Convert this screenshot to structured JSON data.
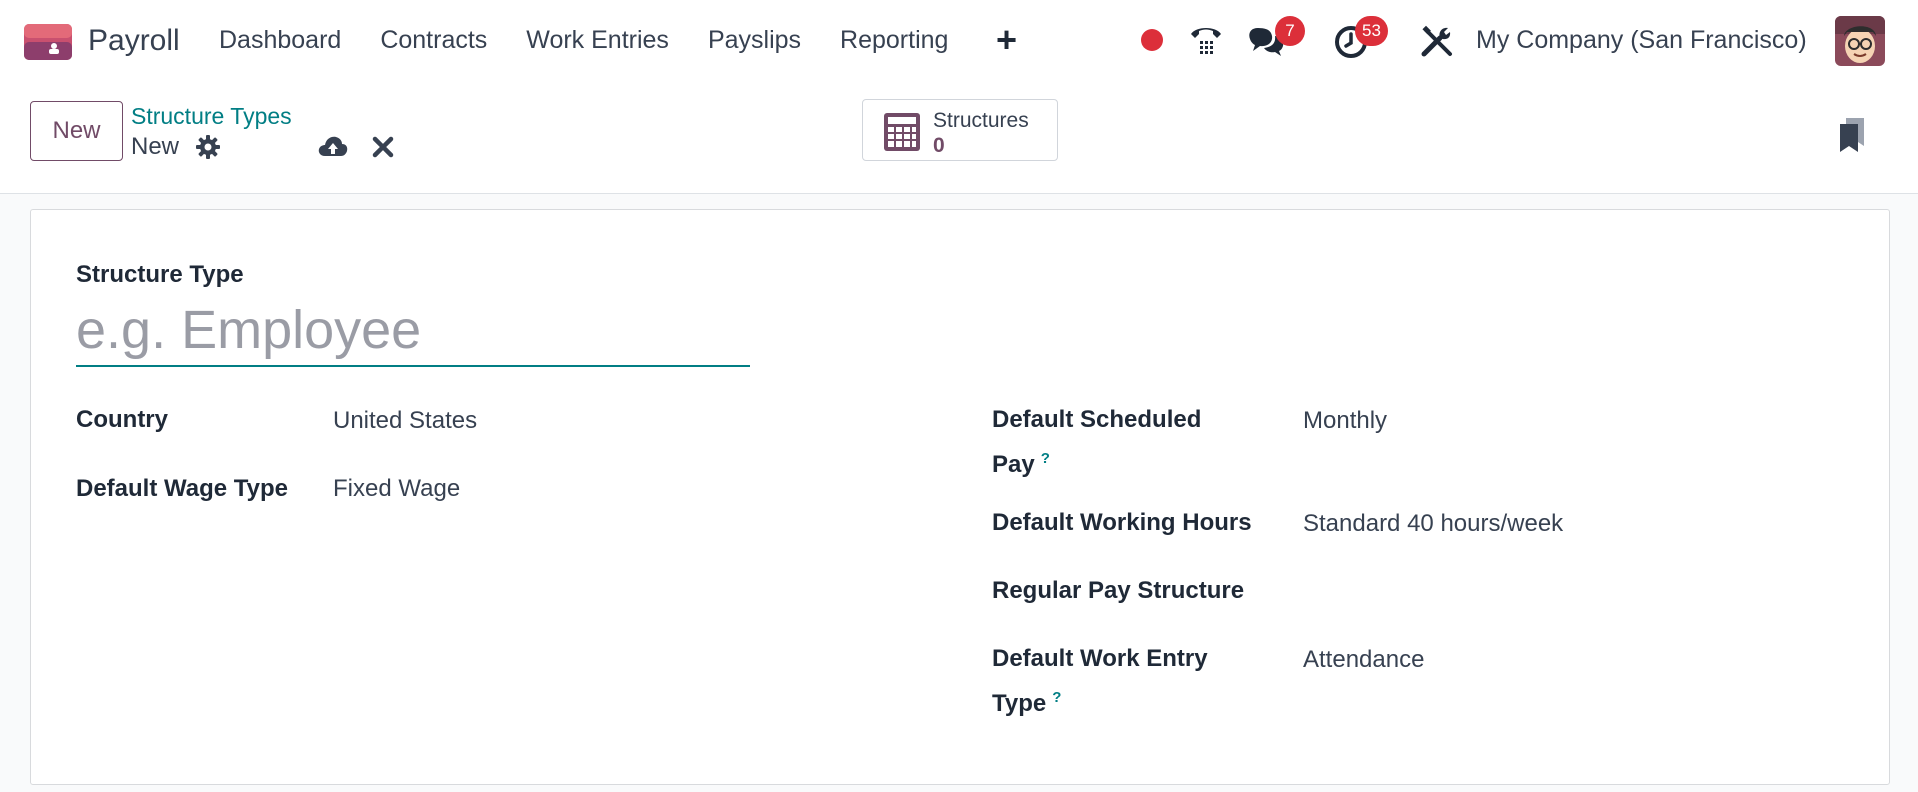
{
  "app": {
    "name": "Payroll",
    "logo_icon": "payroll-app-icon"
  },
  "menu": {
    "items": [
      "Dashboard",
      "Contracts",
      "Work Entries",
      "Payslips",
      "Reporting"
    ],
    "plus": "+"
  },
  "systray": {
    "chat_count": "7",
    "activity_count": "53",
    "company": "My Company (San Francisco)"
  },
  "control_panel": {
    "new_button": "New",
    "breadcrumb_parent": "Structure Types",
    "breadcrumb_current": "New",
    "smart_button": {
      "label": "Structures",
      "value": "0"
    }
  },
  "form": {
    "title_label": "Structure Type",
    "title_placeholder": "e.g. Employee",
    "title_value": "",
    "left_fields": [
      {
        "label": "Country",
        "value": "United States"
      },
      {
        "label": "Default Wage Type",
        "value": "Fixed Wage"
      }
    ],
    "right_fields": [
      {
        "label_line1": "Default Scheduled",
        "label_line2": "Pay",
        "help": "?",
        "value": "Monthly"
      },
      {
        "label": "Default Working Hours",
        "value": "Standard 40 hours/week"
      },
      {
        "label": "Regular Pay Structure",
        "value": ""
      },
      {
        "label_line1": "Default Work Entry",
        "label_line2": "Type",
        "help": "?",
        "value": "Attendance"
      }
    ]
  },
  "colors": {
    "brand": "#714b67",
    "link": "#017e84",
    "badge": "#dc2f3a"
  }
}
